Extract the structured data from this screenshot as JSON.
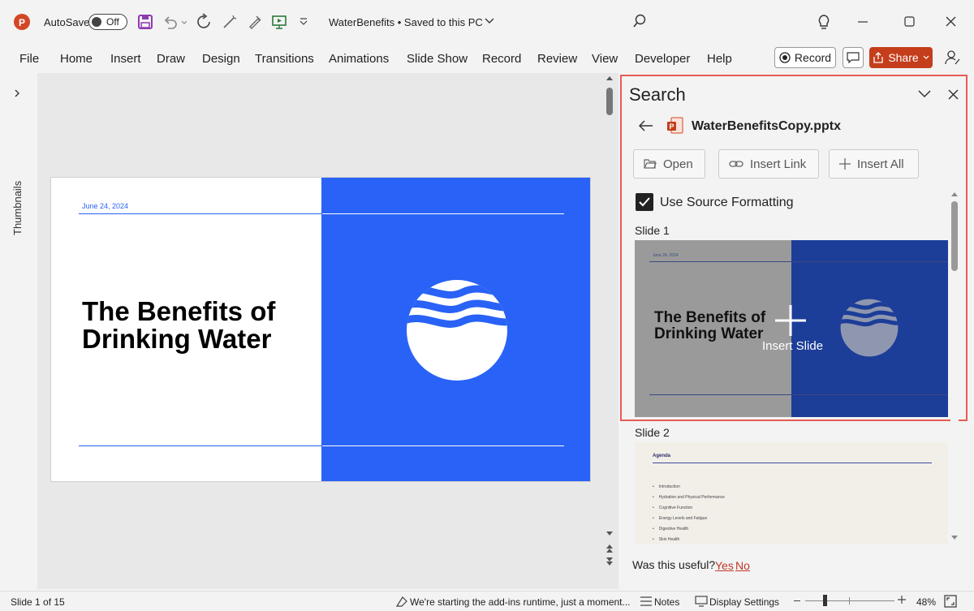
{
  "titlebar": {
    "app_icon": "powerpoint-logo",
    "autosave_label": "AutoSave",
    "autosave_state": "Off",
    "doc_title": "WaterBenefits • Saved to this PC",
    "search_icon": "search-icon"
  },
  "ribbon": {
    "tabs": [
      "File",
      "Home",
      "Insert",
      "Draw",
      "Design",
      "Transitions",
      "Animations",
      "Slide Show",
      "Record",
      "Review",
      "View",
      "Developer",
      "Help"
    ],
    "record_label": "Record",
    "share_label": "Share"
  },
  "thumbnails_label": "Thumbnails",
  "slide": {
    "date": "June 24, 2024",
    "title": "The Benefits of Drinking Water",
    "accent": "#2962f6"
  },
  "pane": {
    "title": "Search",
    "file_name": "WaterBenefitsCopy.pptx",
    "buttons": {
      "open": "Open",
      "insert_link": "Insert Link",
      "insert_all": "Insert All"
    },
    "use_source_formatting": "Use Source Formatting",
    "slide1_label": "Slide 1",
    "slide1": {
      "date": "June 24, 2024",
      "title": "The Benefits of Drinking Water",
      "overlay": "Insert Slide"
    },
    "slide2_label": "Slide 2",
    "slide2": {
      "heading": "Agenda",
      "items": [
        "Introduction",
        "Hydration and Physical Performance",
        "Cognitive Function",
        "Energy Levels and Fatigue",
        "Digestive Health",
        "Skin Health"
      ]
    },
    "feedback": {
      "question": "Was this useful?",
      "yes": "Yes",
      "no": "No"
    },
    "highlight_color": "#e65b55"
  },
  "status": {
    "slide_info": "Slide 1 of 15",
    "addins_msg": "We're starting the add-ins runtime, just a moment...",
    "notes": "Notes",
    "display_settings": "Display Settings",
    "zoom": "48%"
  }
}
